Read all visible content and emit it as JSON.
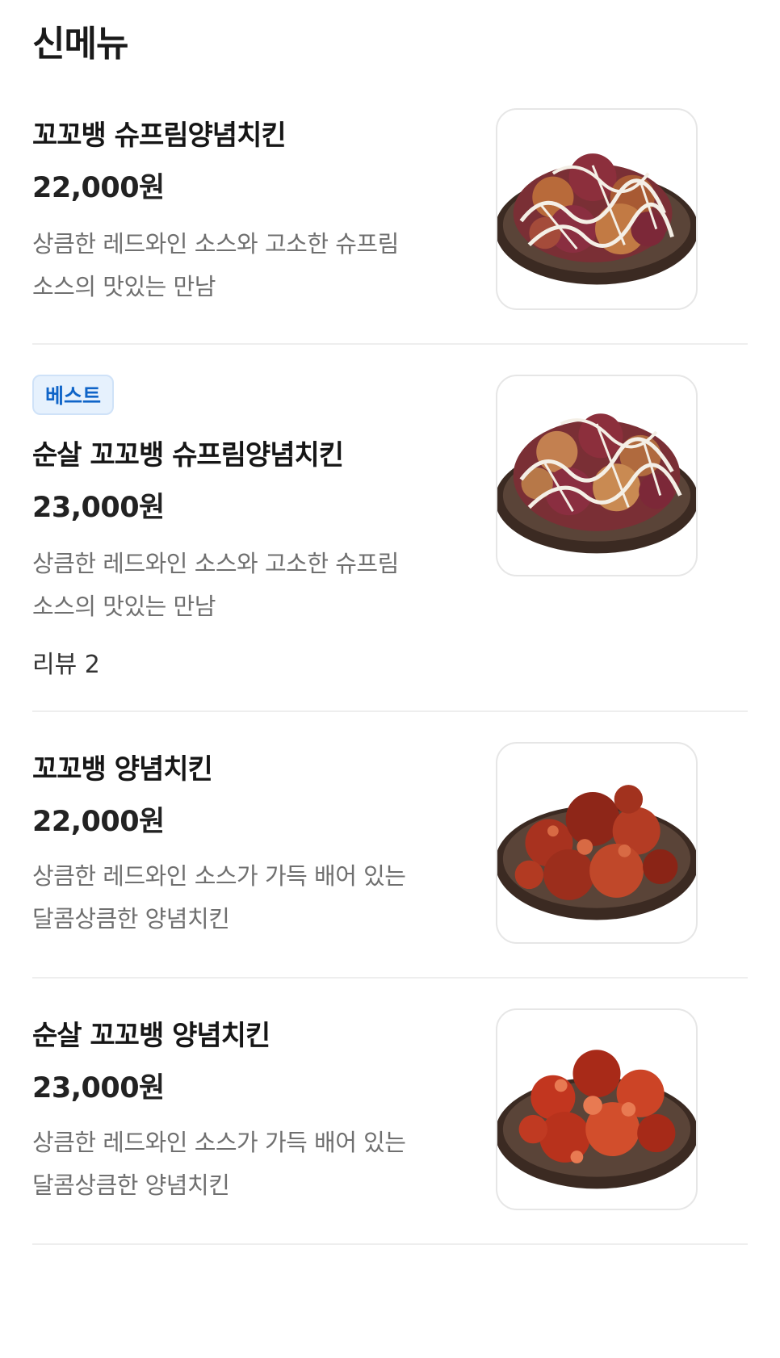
{
  "section": {
    "title": "신메뉴"
  },
  "items": [
    {
      "name": "꼬꼬뱅 슈프림양념치킨",
      "price": "22,000원",
      "desc_line1": "상큼한 레드와인 소스와 고소한 슈프림",
      "desc_line2": "소스의 맛있는 만남",
      "image_icon": "supreme-sauce-chicken-image"
    },
    {
      "badge": "베스트",
      "name": "순살 꼬꼬뱅 슈프림양념치킨",
      "price": "23,000원",
      "desc_line1": "상큼한 레드와인 소스와 고소한 슈프림",
      "desc_line2": "소스의 맛있는 만남",
      "review": "리뷰 2",
      "image_icon": "supreme-sauce-boneless-chicken-image"
    },
    {
      "name": "꼬꼬뱅 양념치킨",
      "price": "22,000원",
      "desc_line1": "상큼한 레드와인 소스가 가득 배어 있는",
      "desc_line2": "달콤상큼한 양념치킨",
      "image_icon": "red-sauce-chicken-image"
    },
    {
      "name": "순살 꼬꼬뱅 양념치킨",
      "price": "23,000원",
      "desc_line1": "상큼한 레드와인 소스가 가득 배어 있는",
      "desc_line2": "달콤상큼한 양념치킨",
      "image_icon": "red-sauce-boneless-chicken-image"
    }
  ],
  "colors": {
    "badge_text": "#0f64c8",
    "badge_bg": "#e6f1fd",
    "divider": "#eeeeee"
  }
}
